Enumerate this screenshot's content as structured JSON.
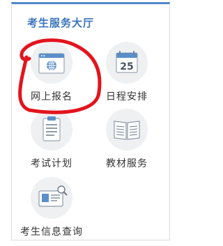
{
  "panel": {
    "title": "考生服务大厅",
    "accent_color": "#4f86c9",
    "title_color": "#3a74bd"
  },
  "tiles": [
    {
      "label": "网上报名",
      "icon": "browser-globe-icon"
    },
    {
      "label": "日程安排",
      "icon": "calendar-icon",
      "calendar_day": "25"
    },
    {
      "label": "考试计划",
      "icon": "clipboard-list-icon"
    },
    {
      "label": "教材服务",
      "icon": "open-book-icon"
    },
    {
      "label": "考生信息查询",
      "icon": "id-card-icon"
    }
  ],
  "annotation": {
    "color": "#e3141d"
  }
}
